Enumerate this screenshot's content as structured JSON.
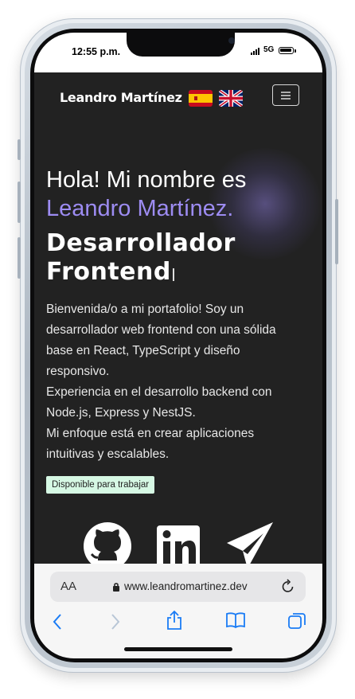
{
  "status_bar": {
    "time": "12:55 p.m.",
    "network": "5G"
  },
  "header": {
    "brand": "Leandro Martínez",
    "flags": [
      "spain-flag",
      "uk-flag"
    ],
    "menu_icon": "hamburger-icon"
  },
  "hero": {
    "greeting": "Hola! Mi nombre es",
    "name": "Leandro Martínez.",
    "role_line1": "Desarrollador",
    "role_line2": "Frontend",
    "bio": [
      "Bienvenida/o a mi portafolio! Soy un desarrollador web frontend con una sólida base en React, TypeScript y diseño responsivo.",
      "Experiencia en el desarrollo backend con Node.js, Express y NestJS.",
      "Mi enfoque está en crear aplicaciones intuitivas y escalables."
    ],
    "badge": "Disponible para trabajar",
    "social_icons": [
      "github-icon",
      "linkedin-icon",
      "telegram-icon"
    ]
  },
  "browser": {
    "text_size_label": "AA",
    "url": "www.leandromartinez.dev",
    "toolbar": [
      "back-icon",
      "forward-icon",
      "share-icon",
      "bookmarks-icon",
      "tabs-icon"
    ]
  },
  "colors": {
    "background": "#222222",
    "accent": "#9d8cf2",
    "badge_bg": "#d6f8e4",
    "browser_bar": "#f6f6f6"
  }
}
